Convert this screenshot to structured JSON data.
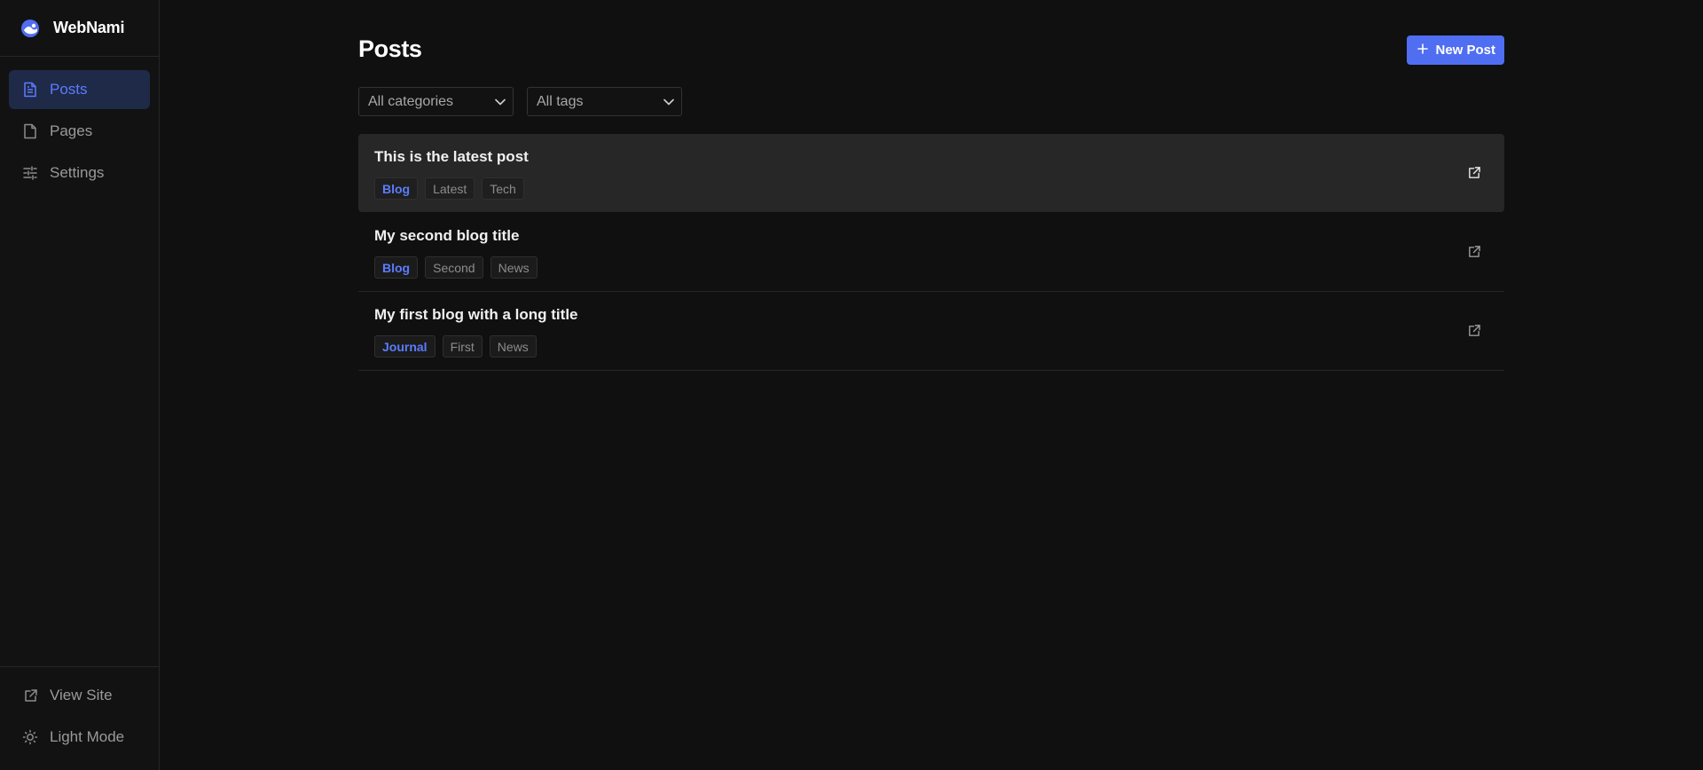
{
  "brand": {
    "name": "WebNami"
  },
  "sidebar": {
    "items": [
      {
        "label": "Posts",
        "icon": "file-text-icon",
        "active": true
      },
      {
        "label": "Pages",
        "icon": "file-icon",
        "active": false
      },
      {
        "label": "Settings",
        "icon": "sliders-icon",
        "active": false
      }
    ],
    "footer": [
      {
        "label": "View Site",
        "icon": "external-link-icon"
      },
      {
        "label": "Light Mode",
        "icon": "sun-icon"
      }
    ]
  },
  "main": {
    "title": "Posts",
    "new_post_label": "New Post",
    "filters": {
      "category": "All categories",
      "tag": "All tags"
    },
    "posts": [
      {
        "title": "This is the latest post",
        "category": "Blog",
        "tags": [
          "Latest",
          "Tech"
        ],
        "highlighted": true
      },
      {
        "title": "My second blog title",
        "category": "Blog",
        "tags": [
          "Second",
          "News"
        ],
        "highlighted": false
      },
      {
        "title": "My first blog with a long title",
        "category": "Journal",
        "tags": [
          "First",
          "News"
        ],
        "highlighted": false
      }
    ]
  },
  "colors": {
    "accent": "#4f6ef2",
    "accent_text": "#5b7cff",
    "background": "#101010",
    "active_nav_bg": "#1e2a47"
  }
}
